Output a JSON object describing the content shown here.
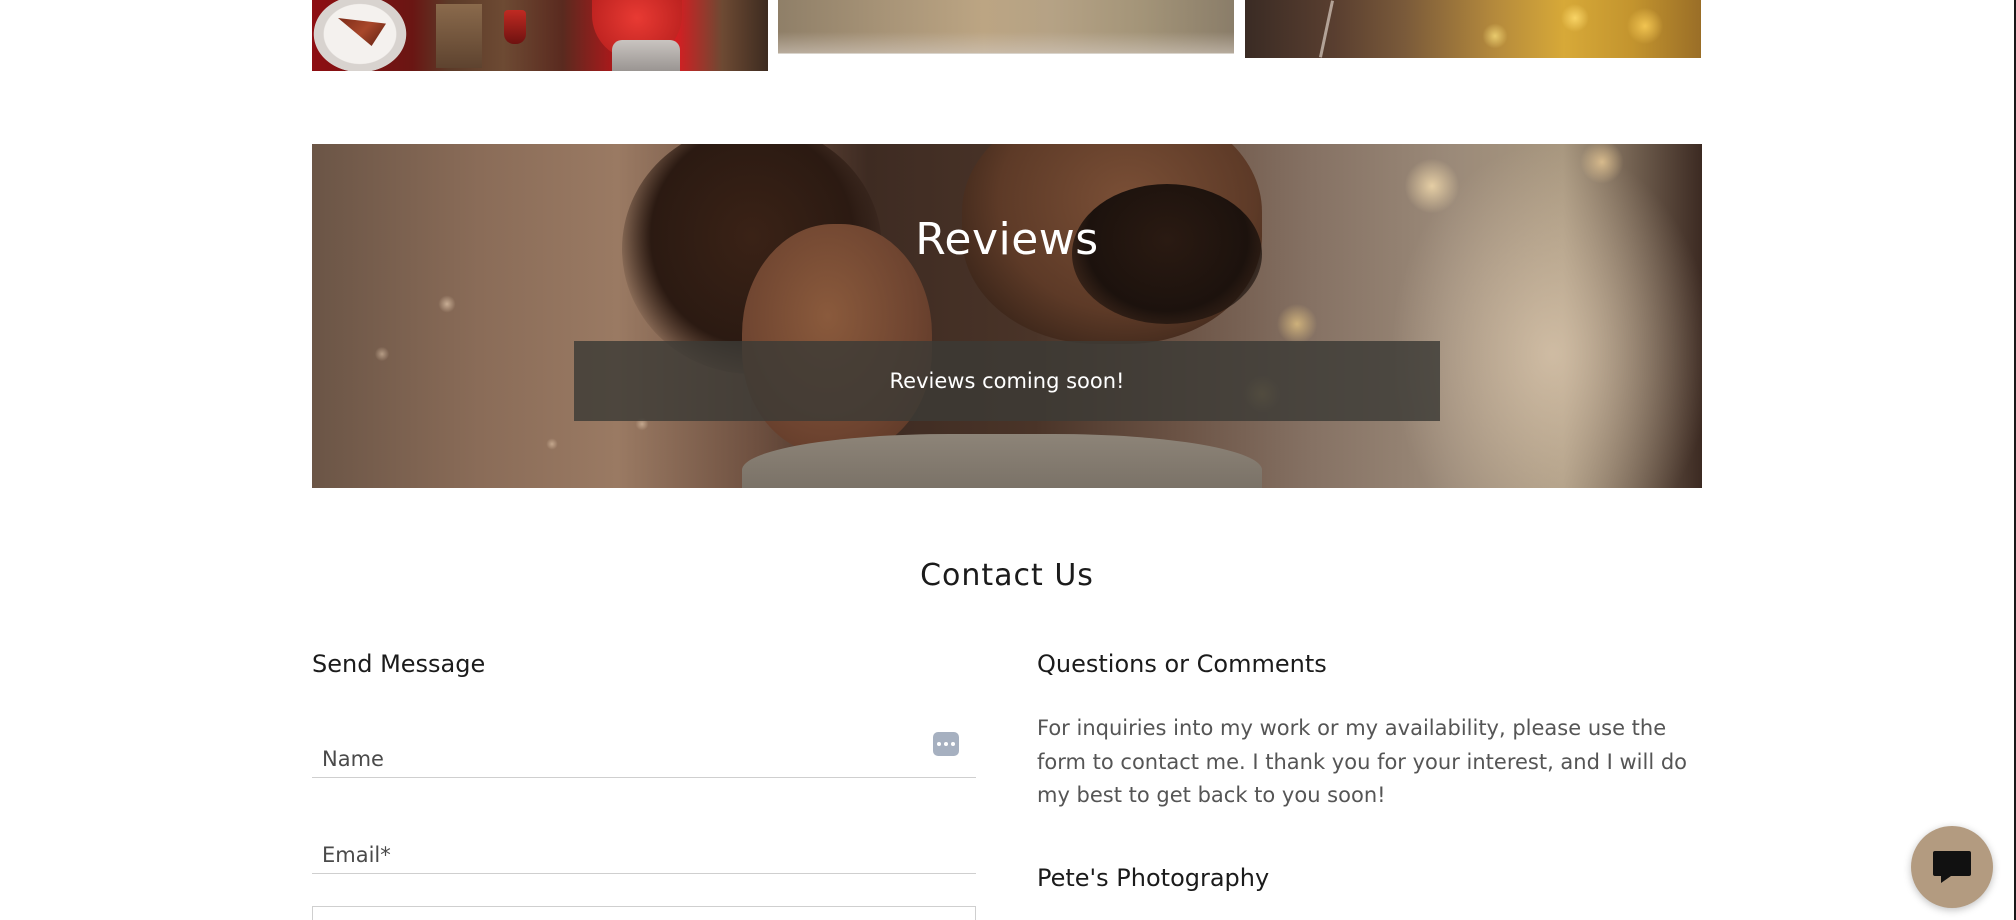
{
  "gallery": {
    "images": [
      {
        "name": "gallery-image-holiday-table"
      },
      {
        "name": "gallery-image-field"
      },
      {
        "name": "gallery-image-golden-bokeh"
      }
    ]
  },
  "reviews": {
    "title": "Reviews",
    "message": "Reviews coming soon!"
  },
  "contact": {
    "title": "Contact Us",
    "send_message_heading": "Send Message",
    "fields": {
      "name_placeholder": "Name",
      "email_placeholder": "Email*"
    },
    "questions_heading": "Questions or Comments",
    "questions_text": "For inquiries into my work or my availability, please use the form to contact me. I thank you for your interest, and I will do my best to get back to you soon!",
    "business_name": "Pete's Photography"
  },
  "chat": {
    "icon": "chat-bubble-icon",
    "color": "#b39b80"
  }
}
